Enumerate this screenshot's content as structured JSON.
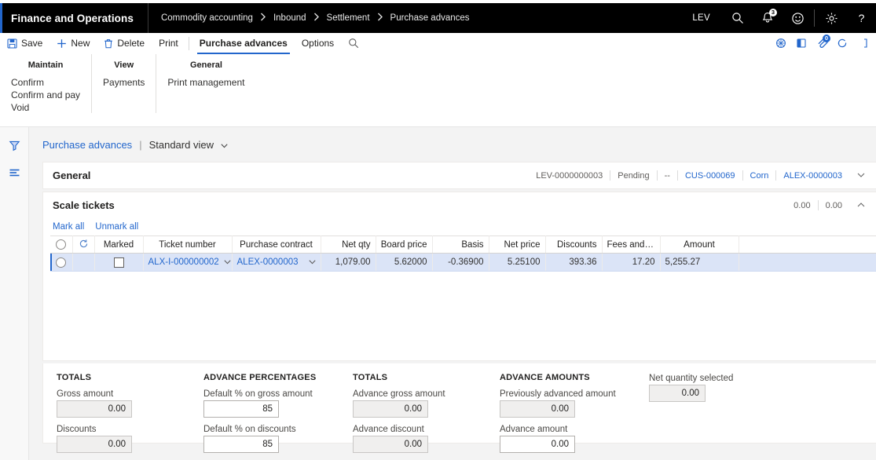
{
  "navbar": {
    "brand": "Finance and Operations",
    "breadcrumb": [
      "Commodity accounting",
      "Inbound",
      "Settlement",
      "Purchase advances"
    ],
    "company": "LEV",
    "icons": [
      {
        "name": "search-icon",
        "glyph": "search"
      },
      {
        "name": "notifications-icon",
        "glyph": "bell",
        "badge": "3"
      },
      {
        "name": "feedback-smiley-icon",
        "glyph": "smiley"
      },
      {
        "name": "settings-gear-icon",
        "glyph": "gear"
      },
      {
        "name": "help-icon",
        "glyph": "question"
      }
    ]
  },
  "toolbar": {
    "save_label": "Save",
    "new_label": "New",
    "delete_label": "Delete",
    "print_label": "Print",
    "tab_purchase_advances": "Purchase advances",
    "tab_options": "Options",
    "search_icon": "search-icon",
    "right_icons": [
      {
        "name": "share-icon"
      },
      {
        "name": "open-in-new-window-icon"
      },
      {
        "name": "attachments-icon",
        "badge": "0"
      },
      {
        "name": "refresh-icon"
      },
      {
        "name": "expand-icon"
      }
    ]
  },
  "ribbon": {
    "groups": [
      {
        "title": "Maintain",
        "items": [
          "Confirm",
          "Confirm and pay",
          "Void"
        ]
      },
      {
        "title": "View",
        "items": [
          "Payments"
        ]
      },
      {
        "title": "General",
        "items": [
          "Print management"
        ]
      }
    ]
  },
  "rail": {
    "filter_icon": "filter-funnel-icon",
    "list_icon": "list-lines-icon"
  },
  "page": {
    "title": "Purchase advances",
    "separator": "|",
    "view": "Standard view",
    "view_chevron": "⌄"
  },
  "general_card": {
    "title": "General",
    "summary": [
      "LEV-0000000003",
      "Pending",
      "--",
      "CUS-000069",
      "Corn",
      "ALEX-0000003"
    ],
    "summary_links": [
      false,
      false,
      false,
      true,
      true,
      true
    ],
    "chevron": "⌄"
  },
  "scale_tickets_card": {
    "title": "Scale tickets",
    "summary": [
      "0.00",
      "0.00"
    ],
    "chevron": "˄",
    "grid_tools": {
      "mark_all": "Mark all",
      "unmark_all": "Unmark all"
    },
    "columns": [
      {
        "label": "",
        "name": "select-radio-col",
        "align": "ctr"
      },
      {
        "label": "",
        "name": "refresh-col",
        "align": "ctr"
      },
      {
        "label": "Marked",
        "name": "marked-col",
        "align": "left"
      },
      {
        "label": "Ticket number",
        "name": "ticket-number-col",
        "align": "left"
      },
      {
        "label": "Purchase contract",
        "name": "purchase-contract-col",
        "align": "left"
      },
      {
        "label": "Net qty",
        "name": "net-qty-col",
        "align": "num"
      },
      {
        "label": "Board price",
        "name": "board-price-col",
        "align": "num"
      },
      {
        "label": "Basis",
        "name": "basis-col",
        "align": "num"
      },
      {
        "label": "Net price",
        "name": "net-price-col",
        "align": "num"
      },
      {
        "label": "Discounts",
        "name": "discounts-col",
        "align": "num"
      },
      {
        "label": "Fees and charg...",
        "name": "fees-and-charges-col",
        "align": "left"
      },
      {
        "label": "Amount",
        "name": "amount-col",
        "align": "num"
      }
    ],
    "rows": [
      {
        "marked": false,
        "ticket_number": "ALX-I-000000002",
        "purchase_contract": "ALEX-0000003",
        "net_qty": "1,079.00",
        "board_price": "5.62000",
        "basis": "-0.36900",
        "net_price": "5.25100",
        "discounts": "393.36",
        "fees_and_charges": "17.20",
        "amount": "5,255.27"
      }
    ]
  },
  "footer": {
    "columns": [
      {
        "title": "TOTALS",
        "fields": [
          {
            "label": "Gross amount",
            "value": "0.00",
            "readonly": true
          },
          {
            "label": "Discounts",
            "value": "0.00",
            "readonly": true
          }
        ]
      },
      {
        "title": "ADVANCE PERCENTAGES",
        "fields": [
          {
            "label": "Default % on gross amount",
            "value": "85",
            "readonly": false
          },
          {
            "label": "Default % on discounts",
            "value": "85",
            "readonly": false
          }
        ]
      },
      {
        "title": "TOTALS",
        "fields": [
          {
            "label": "Advance gross amount",
            "value": "0.00",
            "readonly": true
          },
          {
            "label": "Advance discount",
            "value": "0.00",
            "readonly": true
          }
        ]
      },
      {
        "title": "ADVANCE AMOUNTS",
        "fields": [
          {
            "label": "Previously advanced amount",
            "value": "0.00",
            "readonly": true
          },
          {
            "label": "Advance amount",
            "value": "0.00",
            "readonly": false
          }
        ]
      }
    ],
    "net_quantity": {
      "label": "Net quantity selected",
      "value": "0.00"
    }
  },
  "colors": {
    "accent": "#2266cc",
    "navbar_bg": "#000000",
    "selected_row": "#dbe4f7",
    "page_bg": "#f3f3f3"
  }
}
